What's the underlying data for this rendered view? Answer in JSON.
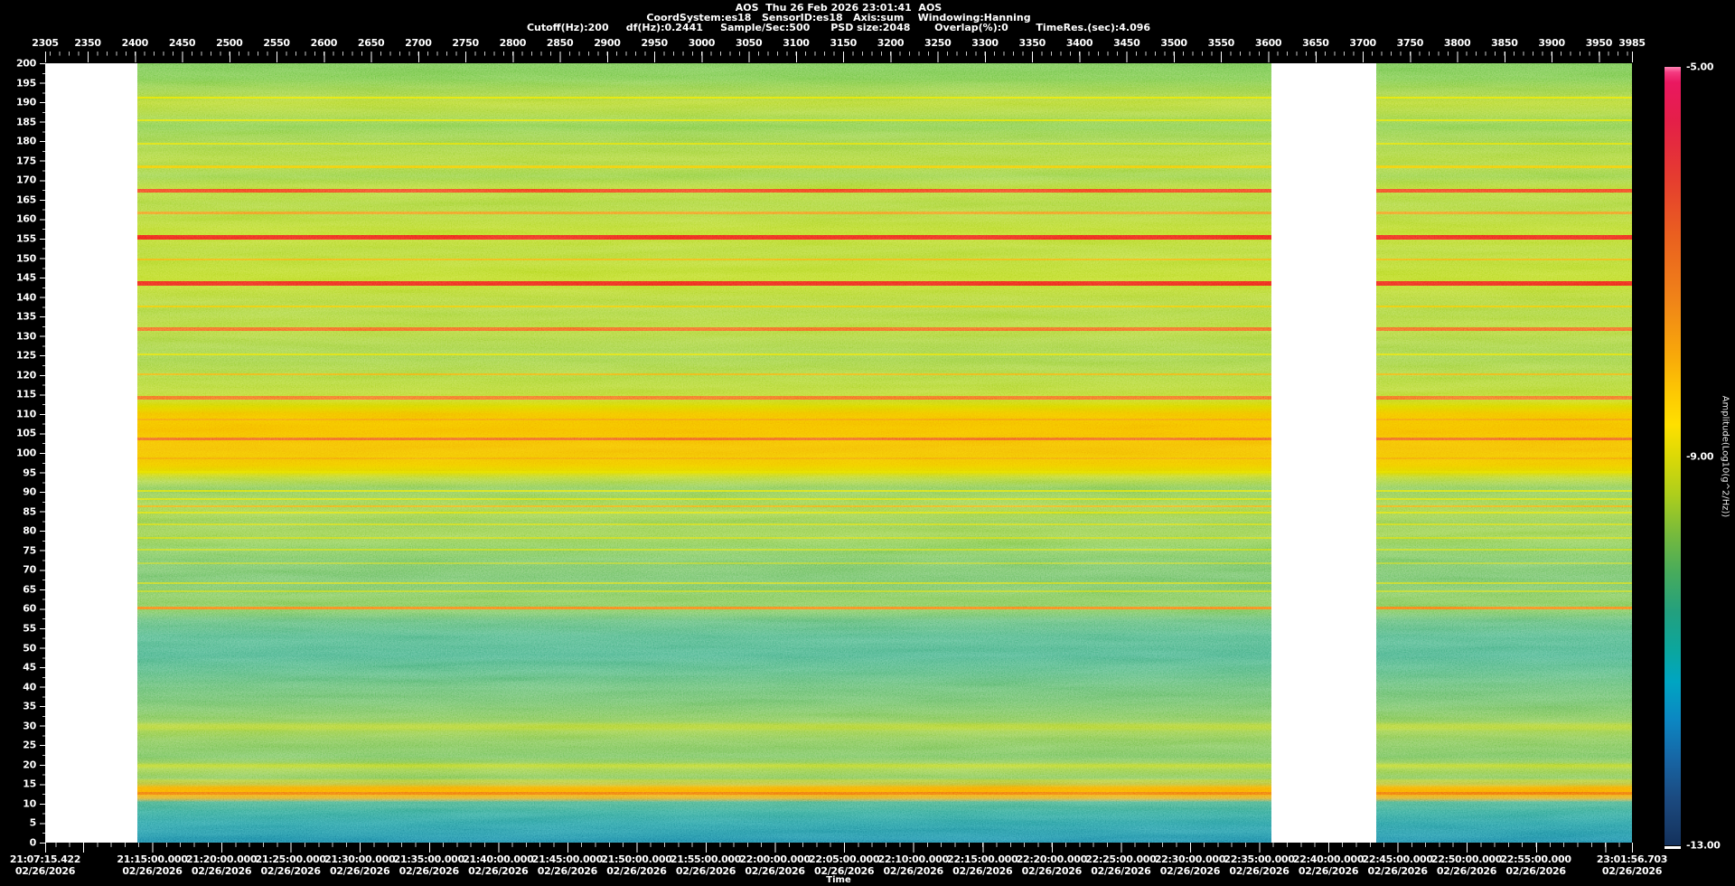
{
  "header": {
    "title": "AOS  Thu 26 Feb 2026 23:01:41  AOS",
    "line2": "CoordSystem:es18   SensorID:es18   Axis:sum    Windowing:Hanning",
    "line3": "Cutoff(Hz):200     df(Hz):0.2441     Sample/Sec:500      PSD size:2048       Overlap(%):0        TimeRes.(sec):4.096"
  },
  "chart_data": {
    "type": "heatmap",
    "title": "AOS  Thu 26 Feb 2026 23:01:41  AOS",
    "subtitle": "Spectrogram, sensor es18, sum axis, Hanning window",
    "record_axis": {
      "min": 2305,
      "max": 3985,
      "ticks": [
        2305,
        2350,
        2400,
        2450,
        2500,
        2550,
        2600,
        2650,
        2700,
        2750,
        2800,
        2850,
        2900,
        2950,
        3000,
        3050,
        3100,
        3150,
        3200,
        3250,
        3300,
        3350,
        3400,
        3450,
        3500,
        3550,
        3600,
        3650,
        3700,
        3750,
        3800,
        3850,
        3900,
        3950,
        3985
      ]
    },
    "freq_axis": {
      "min": 0,
      "max": 200,
      "step": 5,
      "unit": "Hz"
    },
    "time_axis": {
      "label": "Time",
      "start": "21:07:15.422",
      "end": "23:01:56.703",
      "date": "02/26/2026",
      "labels": [
        {
          "time": "21:07:15.422",
          "date": "02/26/2026",
          "pct": 0
        },
        {
          "time": "21:15:00.000",
          "date": "02/26/2026",
          "pct": 6.75
        },
        {
          "time": "21:20:00.000",
          "date": "02/26/2026",
          "pct": 11.11
        },
        {
          "time": "21:25:00.000",
          "date": "02/26/2026",
          "pct": 15.47
        },
        {
          "time": "21:30:00.000",
          "date": "02/26/2026",
          "pct": 19.83
        },
        {
          "time": "21:35:00.000",
          "date": "02/26/2026",
          "pct": 24.19
        },
        {
          "time": "21:40:00.000",
          "date": "02/26/2026",
          "pct": 28.55
        },
        {
          "time": "21:45:00.000",
          "date": "02/26/2026",
          "pct": 32.91
        },
        {
          "time": "21:50:00.000",
          "date": "02/26/2026",
          "pct": 37.27
        },
        {
          "time": "21:55:00.000",
          "date": "02/26/2026",
          "pct": 41.63
        },
        {
          "time": "22:00:00.000",
          "date": "02/26/2026",
          "pct": 45.99
        },
        {
          "time": "22:05:00.000",
          "date": "02/26/2026",
          "pct": 50.35
        },
        {
          "time": "22:10:00.000",
          "date": "02/26/2026",
          "pct": 54.71
        },
        {
          "time": "22:15:00.000",
          "date": "02/26/2026",
          "pct": 59.07
        },
        {
          "time": "22:20:00.000",
          "date": "02/26/2026",
          "pct": 63.43
        },
        {
          "time": "22:25:00.000",
          "date": "02/26/2026",
          "pct": 67.79
        },
        {
          "time": "22:30:00.000",
          "date": "02/26/2026",
          "pct": 72.15
        },
        {
          "time": "22:35:00.000",
          "date": "02/26/2026",
          "pct": 76.51
        },
        {
          "time": "22:40:00.000",
          "date": "02/26/2026",
          "pct": 80.87
        },
        {
          "time": "22:45:00.000",
          "date": "02/26/2026",
          "pct": 85.23
        },
        {
          "time": "22:50:00.000",
          "date": "02/26/2026",
          "pct": 89.58
        },
        {
          "time": "22:55:00.000",
          "date": "02/26/2026",
          "pct": 93.94
        },
        {
          "time": "23:01:56.703",
          "date": "02/26/2026",
          "pct": 100
        }
      ]
    },
    "colorbar": {
      "label": "Amplitude(Log10(g^2/Hz))",
      "tick_labels": [
        {
          "text": "-5.00",
          "pct": 0
        },
        {
          "text": "-9.00",
          "pct": 50
        },
        {
          "text": "-13.00",
          "pct": 100
        }
      ],
      "stops": [
        [
          0,
          "#ff86b6"
        ],
        [
          0.7,
          "#f43a80"
        ],
        [
          2,
          "#ea1760"
        ],
        [
          7,
          "#e41f48"
        ],
        [
          14,
          "#e53b30"
        ],
        [
          22,
          "#ea611f"
        ],
        [
          30,
          "#f08418"
        ],
        [
          37,
          "#f8a80a"
        ],
        [
          42,
          "#fdc903"
        ],
        [
          46,
          "#ffe000"
        ],
        [
          50,
          "#dcd906"
        ],
        [
          55,
          "#adce1c"
        ],
        [
          60,
          "#77ba3c"
        ],
        [
          65,
          "#47ab5c"
        ],
        [
          70,
          "#23a07e"
        ],
        [
          75,
          "#0ba69e"
        ],
        [
          79,
          "#00a5c2"
        ],
        [
          84,
          "#0c86c2"
        ],
        [
          89,
          "#1765a4"
        ],
        [
          94,
          "#1b4a80"
        ],
        [
          98,
          "#173a68"
        ],
        [
          100,
          "#13315c"
        ]
      ]
    },
    "data_gaps": [
      {
        "left_pct": 0,
        "width_pct": 5.81,
        "approx_time": "21:07:15 - 21:13:50"
      },
      {
        "left_pct": 77.28,
        "width_pct": 6.61,
        "approx_time": "22:35:53 - 22:43:28"
      }
    ],
    "base_gradient": [
      [
        0,
        "#57b434"
      ],
      [
        2,
        "#5eba30"
      ],
      [
        4,
        "#86c426"
      ],
      [
        5,
        "#a2cc1a"
      ],
      [
        6.5,
        "#8fc824"
      ],
      [
        8,
        "#6cc030"
      ],
      [
        10,
        "#82c42a"
      ],
      [
        12.5,
        "#97ca20"
      ],
      [
        14.5,
        "#7ec42c"
      ],
      [
        16,
        "#a0cc1c"
      ],
      [
        18,
        "#92c822"
      ],
      [
        20,
        "#9ecc1e"
      ],
      [
        22,
        "#aad014"
      ],
      [
        24,
        "#9ecc1e"
      ],
      [
        26,
        "#a4ce18"
      ],
      [
        28,
        "#aad014"
      ],
      [
        30,
        "#9eca1e"
      ],
      [
        32,
        "#92c824"
      ],
      [
        34,
        "#9eca1e"
      ],
      [
        36,
        "#8ec628"
      ],
      [
        38,
        "#86c42a"
      ],
      [
        40.5,
        "#98ca20"
      ],
      [
        42.5,
        "#a4cc1a"
      ],
      [
        44,
        "#cac600"
      ],
      [
        45,
        "#eeac00"
      ],
      [
        47,
        "#f2a600"
      ],
      [
        49.5,
        "#f0a802"
      ],
      [
        51.5,
        "#ecb400"
      ],
      [
        52.5,
        "#d2ca00"
      ],
      [
        53.3,
        "#9eca1e"
      ],
      [
        54.5,
        "#6aba3a"
      ],
      [
        56,
        "#7ec230"
      ],
      [
        57.5,
        "#8ac62a"
      ],
      [
        59,
        "#76be34"
      ],
      [
        60.5,
        "#7ec230"
      ],
      [
        62,
        "#6abc3c"
      ],
      [
        64,
        "#5ab446"
      ],
      [
        66,
        "#54b04c"
      ],
      [
        68,
        "#62b83e"
      ],
      [
        70,
        "#68ba3a"
      ],
      [
        71.5,
        "#46aa5e"
      ],
      [
        73.5,
        "#35a26c"
      ],
      [
        76,
        "#309e70"
      ],
      [
        78,
        "#3aa464"
      ],
      [
        80,
        "#48aa56"
      ],
      [
        82,
        "#52ae4c"
      ],
      [
        84,
        "#64b63c"
      ],
      [
        85.5,
        "#82c02a"
      ],
      [
        87,
        "#66b63a"
      ],
      [
        89,
        "#5ab242"
      ],
      [
        90.5,
        "#86c22a"
      ],
      [
        91.8,
        "#62b43e"
      ],
      [
        92.8,
        "#caaa10"
      ],
      [
        93.5,
        "#ea8e12"
      ],
      [
        94.3,
        "#d19c16"
      ],
      [
        94.8,
        "#309c6e"
      ],
      [
        96,
        "#1e917c"
      ],
      [
        97.5,
        "#16848a"
      ],
      [
        99,
        "#12788e"
      ],
      [
        100,
        "#0f6c90"
      ]
    ],
    "bands": [
      {
        "f": 191.2,
        "c": "#e6e000",
        "w": 2,
        "o": 0.85
      },
      {
        "f": 185.4,
        "c": "#e2de00",
        "w": 2,
        "o": 0.8
      },
      {
        "f": 179.4,
        "c": "#deda00",
        "w": 2,
        "o": 0.8
      },
      {
        "f": 173.4,
        "c": "#f8ba00",
        "w": 3,
        "o": 0.85
      },
      {
        "f": 167.3,
        "c": "#ee2a10",
        "w": 4
      },
      {
        "f": 161.5,
        "c": "#f07c10",
        "w": 3,
        "o": 0.9
      },
      {
        "f": 155.4,
        "c": "#e8140c",
        "w": 5
      },
      {
        "f": 149.6,
        "c": "#f29c08",
        "w": 2,
        "o": 0.9
      },
      {
        "f": 143.5,
        "c": "#e8140c",
        "w": 5
      },
      {
        "f": 137.7,
        "c": "#f4b600",
        "w": 2,
        "o": 0.85
      },
      {
        "f": 131.7,
        "c": "#ee4a10",
        "w": 4
      },
      {
        "f": 125.4,
        "c": "#e2da00",
        "w": 2,
        "o": 0.8
      },
      {
        "f": 120.3,
        "c": "#f29a06",
        "w": 2,
        "o": 0.85
      },
      {
        "f": 114.2,
        "c": "#ee5410",
        "w": 4
      },
      {
        "f": 108.6,
        "c": "#f58206",
        "w": 2,
        "o": 0.9
      },
      {
        "f": 103.7,
        "c": "#ec480e",
        "w": 3
      },
      {
        "f": 98.6,
        "c": "#f08e04",
        "w": 2,
        "o": 0.9
      },
      {
        "f": 95.2,
        "c": "#ded400",
        "w": 2,
        "o": 0.7
      },
      {
        "f": 90.2,
        "c": "#dcdc00",
        "w": 2,
        "o": 0.8
      },
      {
        "f": 88.1,
        "c": "#e0de00",
        "w": 2,
        "o": 0.75
      },
      {
        "f": 86.2,
        "c": "#f09a0a",
        "w": 2,
        "o": 0.9
      },
      {
        "f": 84.6,
        "c": "#deda00",
        "w": 2,
        "o": 0.75
      },
      {
        "f": 81.6,
        "c": "#d6d600",
        "w": 2,
        "o": 0.7
      },
      {
        "f": 78.2,
        "c": "#ced400",
        "w": 2,
        "o": 0.7
      },
      {
        "f": 75.1,
        "c": "#cad400",
        "w": 2,
        "o": 0.7
      },
      {
        "f": 71.8,
        "c": "#bcce06",
        "w": 2,
        "o": 0.6
      },
      {
        "f": 66.6,
        "c": "#ced400",
        "w": 2,
        "o": 0.7
      },
      {
        "f": 64.4,
        "c": "#c8d202",
        "w": 2,
        "o": 0.65
      },
      {
        "f": 60.2,
        "c": "#f2660c",
        "w": 3
      },
      {
        "f": 29.8,
        "c": "#c2d008",
        "w": 7,
        "o": 0.45,
        "s": 1
      },
      {
        "f": 19.8,
        "c": "#d2d600",
        "w": 4,
        "o": 0.55,
        "s": 1
      },
      {
        "f": 15.8,
        "c": "#d8d200",
        "w": 3,
        "o": 0.5,
        "s": 1
      },
      {
        "f": 13.2,
        "c": "#f89000",
        "w": 10,
        "o": 0.9,
        "s": 1
      },
      {
        "f": 12.6,
        "c": "#ea5a06",
        "w": 3
      }
    ]
  }
}
